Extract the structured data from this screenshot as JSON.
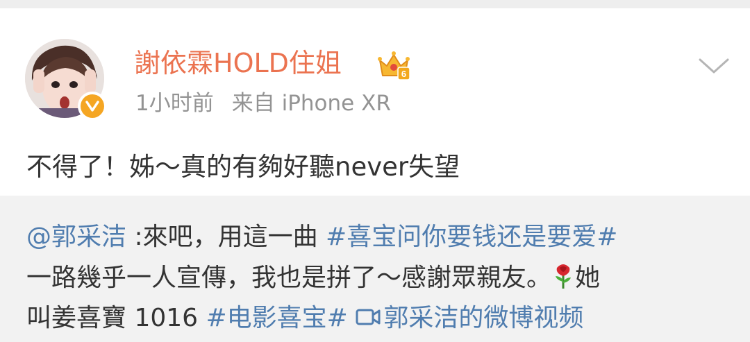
{
  "post": {
    "username": "謝依霖HOLD住姐",
    "member_level": "6",
    "time": "1小时前",
    "source": "来自 iPhone XR",
    "text": "不得了！姊～真的有夠好聽never失望"
  },
  "repost": {
    "mention": "@郭采洁",
    "line1_text": " :來吧，用這一曲 ",
    "hashtag1": "#喜宝问你要钱还是要爱#",
    "line2_text": "一路幾乎一人宣傳，我也是拼了～感謝眾親友。",
    "line2_end": "她",
    "line3_text": "叫姜喜寶 1016 ",
    "hashtag2": "#电影喜宝#",
    "video_link": "郭采洁的微博视频"
  },
  "colors": {
    "username": "#eb7350",
    "link": "#507daf",
    "meta": "#939393",
    "text": "#333333",
    "repost_bg": "#f2f2f2",
    "verified_badge": "#f5a623"
  },
  "icons": {
    "verified": "verified-v-icon",
    "member": "crown-member-icon",
    "menu": "chevron-down-icon",
    "emoji": "rose-emoji-icon",
    "video": "video-icon"
  }
}
